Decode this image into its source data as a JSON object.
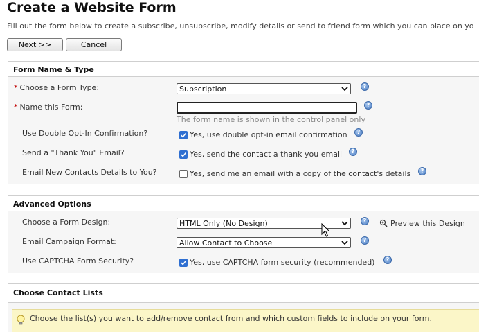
{
  "page": {
    "title": "Create a Website Form",
    "intro": "Fill out the form below to create a subscribe, unsubscribe, modify details or send to friend form which you can place on yo"
  },
  "buttons": {
    "next": "Next >>",
    "cancel": "Cancel"
  },
  "sections": {
    "name_type": {
      "heading": "Form Name & Type",
      "form_type_label": "Choose a Form Type:",
      "form_type_value": "Subscription",
      "form_name_label": "Name this Form:",
      "form_name_value": "",
      "form_name_hint": "The form name is shown in the control panel only",
      "double_optin_label": "Use Double Opt-In Confirmation?",
      "double_optin_text": "Yes, use double opt-in email confirmation",
      "double_optin_checked": true,
      "thankyou_label": "Send a \"Thank You\" Email?",
      "thankyou_text": "Yes, send the contact a thank you email",
      "thankyou_checked": true,
      "notify_label": "Email New Contacts Details to You?",
      "notify_text": "Yes, send me an email with a copy of the contact's details",
      "notify_checked": false
    },
    "advanced": {
      "heading": "Advanced Options",
      "design_label": "Choose a Form Design:",
      "design_value": "HTML Only (No Design)",
      "preview_link": "Preview this Design",
      "format_label": "Email Campaign Format:",
      "format_value": "Allow Contact to Choose",
      "captcha_label": "Use CAPTCHA Form Security?",
      "captcha_text": "Yes, use CAPTCHA form security (recommended)",
      "captcha_checked": true
    },
    "lists": {
      "heading": "Choose Contact Lists",
      "tip": "Choose the list(s) you want to add/remove contact from and which custom fields to include on your form."
    }
  },
  "colors": {
    "accent": "#2f6fd1",
    "required": "#c00000",
    "tip_bg": "#fbf6c8"
  }
}
